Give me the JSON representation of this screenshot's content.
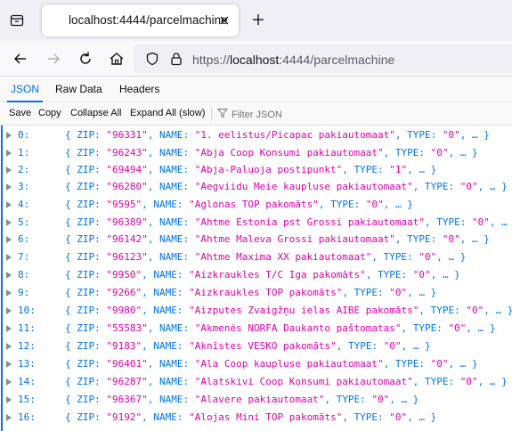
{
  "browser": {
    "tab_title": "localhost:4444/parcelmachine",
    "url_prefix": "https://",
    "url_host": "localhost",
    "url_rest": ":4444/parcelmachine"
  },
  "viewer": {
    "tabs": [
      {
        "label": "JSON",
        "active": true
      },
      {
        "label": "Raw Data",
        "active": false
      },
      {
        "label": "Headers",
        "active": false
      }
    ],
    "toolbar": {
      "save": "Save",
      "copy": "Copy",
      "collapse_all": "Collapse All",
      "expand_all": "Expand All (slow)",
      "filter_placeholder": "Filter JSON"
    }
  },
  "rows": [
    {
      "index": "0:",
      "zip": "\"96331\"",
      "name": "\"1. eelistus/Picapac pakiautomaat\"",
      "type": "\"0\""
    },
    {
      "index": "1:",
      "zip": "\"96243\"",
      "name": "\"Abja Coop Konsumi pakiautomaat\"",
      "type": "\"0\""
    },
    {
      "index": "2:",
      "zip": "\"69494\"",
      "name": "\"Abja-Paluoja postipunkt\"",
      "type": "\"1\""
    },
    {
      "index": "3:",
      "zip": "\"96280\"",
      "name": "\"Aegviidu Meie kaupluse pakiautomaat\"",
      "type": "\"0\""
    },
    {
      "index": "4:",
      "zip": "\"9595\"",
      "name": "\"Aglonas TOP pakomāts\"",
      "type": "\"0\""
    },
    {
      "index": "5:",
      "zip": "\"96389\"",
      "name": "\"Ahtme Estonia pst Grossi pakiautomaat\"",
      "type": "\"0\""
    },
    {
      "index": "6:",
      "zip": "\"96142\"",
      "name": "\"Ahtme Maleva Grossi pakiautomaat\"",
      "type": "\"0\""
    },
    {
      "index": "7:",
      "zip": "\"96123\"",
      "name": "\"Ahtme Maxima XX pakiautomaat\"",
      "type": "\"0\""
    },
    {
      "index": "8:",
      "zip": "\"9950\"",
      "name": "\"Aizkraukles T/C Iga pakomāts\"",
      "type": "\"0\""
    },
    {
      "index": "9:",
      "zip": "\"9266\"",
      "name": "\"Aizkraukles TOP pakomāts\"",
      "type": "\"0\""
    },
    {
      "index": "10:",
      "zip": "\"9980\"",
      "name": "\"Aizputes Zvaigžņu ielas AIBE pakomāts\"",
      "type": "\"0\""
    },
    {
      "index": "11:",
      "zip": "\"55583\"",
      "name": "\"Akmenės NORFA Daukanto paštomatas\"",
      "type": "\"0\""
    },
    {
      "index": "12:",
      "zip": "\"9183\"",
      "name": "\"Aknīstes VESKO pakomāts\"",
      "type": "\"0\""
    },
    {
      "index": "13:",
      "zip": "\"96401\"",
      "name": "\"Ala Coop kaupluse pakiautomaat\"",
      "type": "\"0\""
    },
    {
      "index": "14:",
      "zip": "\"96287\"",
      "name": "\"Alatskivi Coop Konsumi pakiautomaat\"",
      "type": "\"0\""
    },
    {
      "index": "15:",
      "zip": "\"96367\"",
      "name": "\"Alavere pakiautomaat\"",
      "type": "\"0\""
    },
    {
      "index": "16:",
      "zip": "\"9192\"",
      "name": "\"Alojas Mini TOP pakomāts\"",
      "type": "\"0\""
    }
  ],
  "labels": {
    "zip_key": "ZIP:",
    "name_key": "NAME:",
    "type_key": "TYPE:",
    "open": "{",
    "close": "… }"
  },
  "colors": {
    "accent": "#0074e8",
    "string": "#dd00a9"
  }
}
